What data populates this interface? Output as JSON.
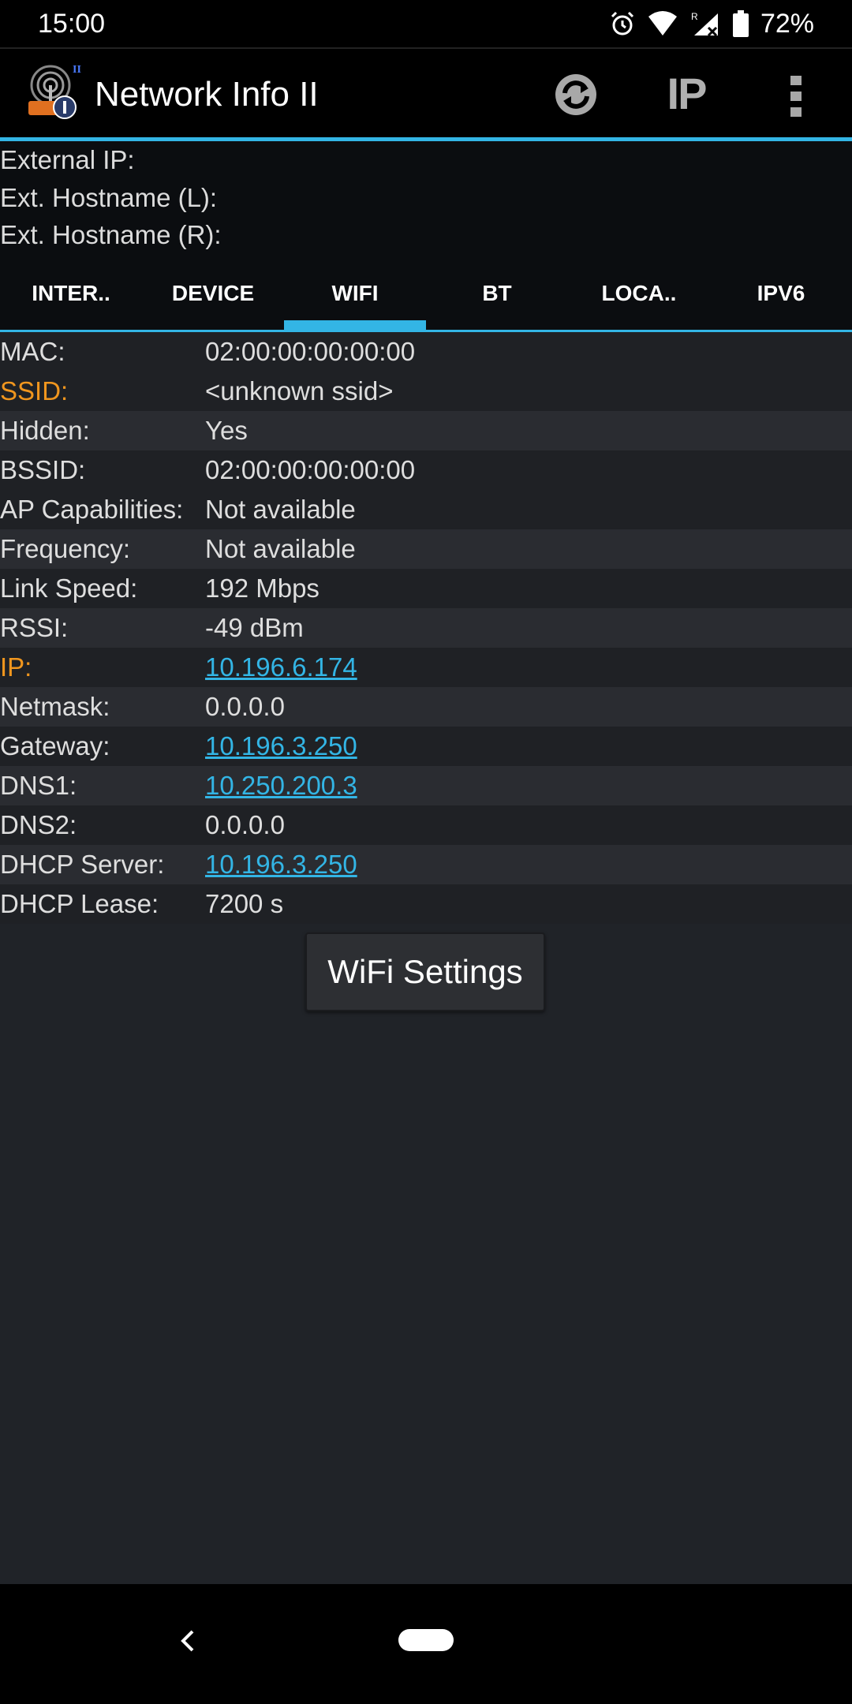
{
  "status_bar": {
    "time": "15:00",
    "battery": "72%",
    "icons": [
      "alarm-icon",
      "wifi-icon",
      "cell-signal-roaming-icon",
      "battery-icon"
    ],
    "roaming_mark": "R"
  },
  "action_bar": {
    "title": "Network Info II",
    "ip_button_label": "IP",
    "icons": [
      "app-logo-icon",
      "refresh-icon",
      "overflow-menu-icon"
    ]
  },
  "external": {
    "external_ip_label": "External IP:",
    "ext_hostname_local_label": "Ext. Hostname (L):",
    "ext_hostname_remote_label": "Ext. Hostname (R):"
  },
  "tabs": [
    {
      "label": "INTER..",
      "selected": false
    },
    {
      "label": "DEVICE",
      "selected": false
    },
    {
      "label": "WIFI",
      "selected": true
    },
    {
      "label": "BT",
      "selected": false
    },
    {
      "label": "LOCA..",
      "selected": false
    },
    {
      "label": "IPV6",
      "selected": false
    }
  ],
  "wifi_info": [
    {
      "label": "MAC:",
      "value": "02:00:00:00:00:00"
    },
    {
      "label": "SSID:",
      "value": "<unknown ssid>"
    },
    {
      "label": "Hidden:",
      "value": "Yes"
    },
    {
      "label": "BSSID:",
      "value": "02:00:00:00:00:00"
    },
    {
      "label": "AP Capabilities:",
      "value": "Not available"
    },
    {
      "label": "Frequency:",
      "value": "Not available"
    },
    {
      "label": "Link Speed:",
      "value": "192 Mbps"
    },
    {
      "label": "RSSI:",
      "value": "-49 dBm"
    },
    {
      "label": "IP:",
      "value": "10.196.6.174"
    },
    {
      "label": "Netmask:",
      "value": "0.0.0.0"
    },
    {
      "label": "Gateway:",
      "value": "10.196.3.250"
    },
    {
      "label": "DNS1:",
      "value": "10.250.200.3"
    },
    {
      "label": "DNS2:",
      "value": "0.0.0.0"
    },
    {
      "label": "DHCP Server:",
      "value": "10.196.3.250"
    },
    {
      "label": "DHCP Lease:",
      "value": "7200 s"
    }
  ],
  "wifi_settings_button": "WiFi Settings",
  "colors": {
    "accent": "#33b5e5",
    "highlight_label": "#f0961e",
    "background": "#202328",
    "row_alt": "#2a2c31"
  }
}
